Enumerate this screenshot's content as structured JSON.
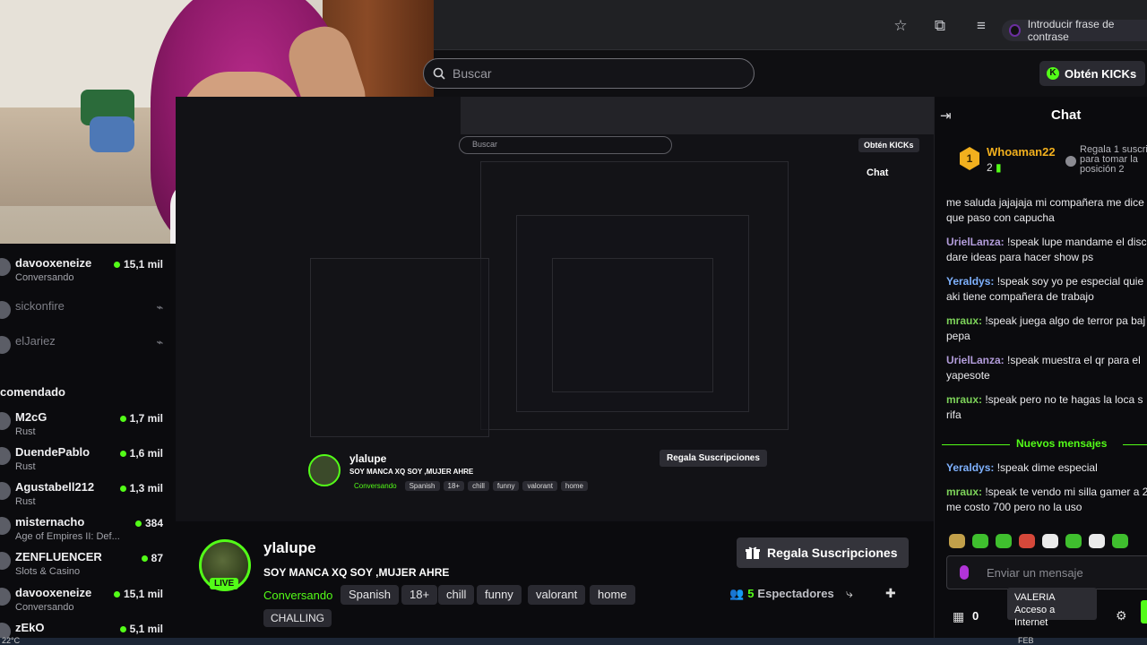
{
  "browser": {
    "password_pill": "Introducir frase de contrase"
  },
  "header": {
    "search_placeholder": "Buscar",
    "kicks_button": "Obtén KICKs"
  },
  "sidebar": {
    "channels": [
      {
        "name": "davooxeneize",
        "sub": "Conversando",
        "viewers": "15,1 mil",
        "live": true
      },
      {
        "name": "sickonfire",
        "sub": "",
        "viewers": "",
        "live": false
      },
      {
        "name": "elJariez",
        "sub": "",
        "viewers": "",
        "live": false
      }
    ],
    "recommended_title": "comendado",
    "recommended": [
      {
        "name": "M2cG",
        "sub": "Rust",
        "viewers": "1,7 mil"
      },
      {
        "name": "DuendePablo",
        "sub": "Rust",
        "viewers": "1,6 mil"
      },
      {
        "name": "Agustabell212",
        "sub": "Rust",
        "viewers": "1,3 mil"
      },
      {
        "name": "misternacho",
        "sub": "Age of Empires II: Def...",
        "viewers": "384"
      },
      {
        "name": "ZENFLUENCER",
        "sub": "Slots & Casino",
        "viewers": "87"
      },
      {
        "name": "davooxeneize",
        "sub": "Conversando",
        "viewers": "15,1 mil"
      },
      {
        "name": "zEkO",
        "sub": "",
        "viewers": "5,1 mil"
      }
    ]
  },
  "chat": {
    "title": "Chat",
    "pinned": {
      "rank": "1",
      "user": "Whoaman22",
      "count": "2",
      "desc": "Regala 1 suscri para tomar la posición 2"
    },
    "messages": [
      {
        "user": "",
        "text": "me saluda jajajaja mi compañera me dice que paso con capucha",
        "color": "#eaeaed"
      },
      {
        "user": "UrielLanza:",
        "text": " !speak lupe mandame el disc dare ideas para hacer show ps",
        "color": "#b39ddb"
      },
      {
        "user": "Yeraldys:",
        "text": " !speak soy yo pe especial quie aki tiene compañera de trabajo",
        "color": "#7fb2ff"
      },
      {
        "user": "mraux:",
        "text": " !speak juega algo de terror pa baj pepa",
        "color": "#7dd35a"
      },
      {
        "user": "UrielLanza:",
        "text": " !speak muestra el qr para el yapesote",
        "color": "#b39ddb"
      },
      {
        "user": "mraux:",
        "text": " !speak pero no te hagas la loca s rifa",
        "color": "#7dd35a"
      }
    ],
    "new_messages_label": "Nuevos mensajes",
    "new_messages": [
      {
        "user": "Yeraldys:",
        "text": " !speak dime especial",
        "color": "#7fb2ff"
      },
      {
        "user": "mraux:",
        "text": " !speak te vendo mi silla gamer a 2 me costo 700 pero no la uso",
        "color": "#7dd35a"
      }
    ],
    "input_placeholder": "Enviar un mensaje",
    "kicks_count": "0",
    "tooltip_user": "VALERIA",
    "tooltip_text": "Acceso a Internet"
  },
  "streamer": {
    "name": "ylalupe",
    "live_badge": "LIVE",
    "title": "SOY MANCA XQ SOY ,MUJER AHRE",
    "category": "Conversando",
    "tags": [
      "Spanish",
      "18+",
      "chill",
      "funny",
      "valorant",
      "home"
    ],
    "tag_extra": "CHALLING",
    "gift_button": "Regala Suscripciones",
    "viewers_count": "5",
    "viewers_label": "Espectadores"
  },
  "mirror": {
    "search": "Buscar",
    "kicks": "Obtén KICKs",
    "chat": "Chat",
    "gift": "Regala Suscripciones"
  },
  "taskbar": {
    "temp": "22°C",
    "date": "FEB"
  },
  "colors": {
    "accent": "#53fc18",
    "rank": "#f2b01e"
  }
}
